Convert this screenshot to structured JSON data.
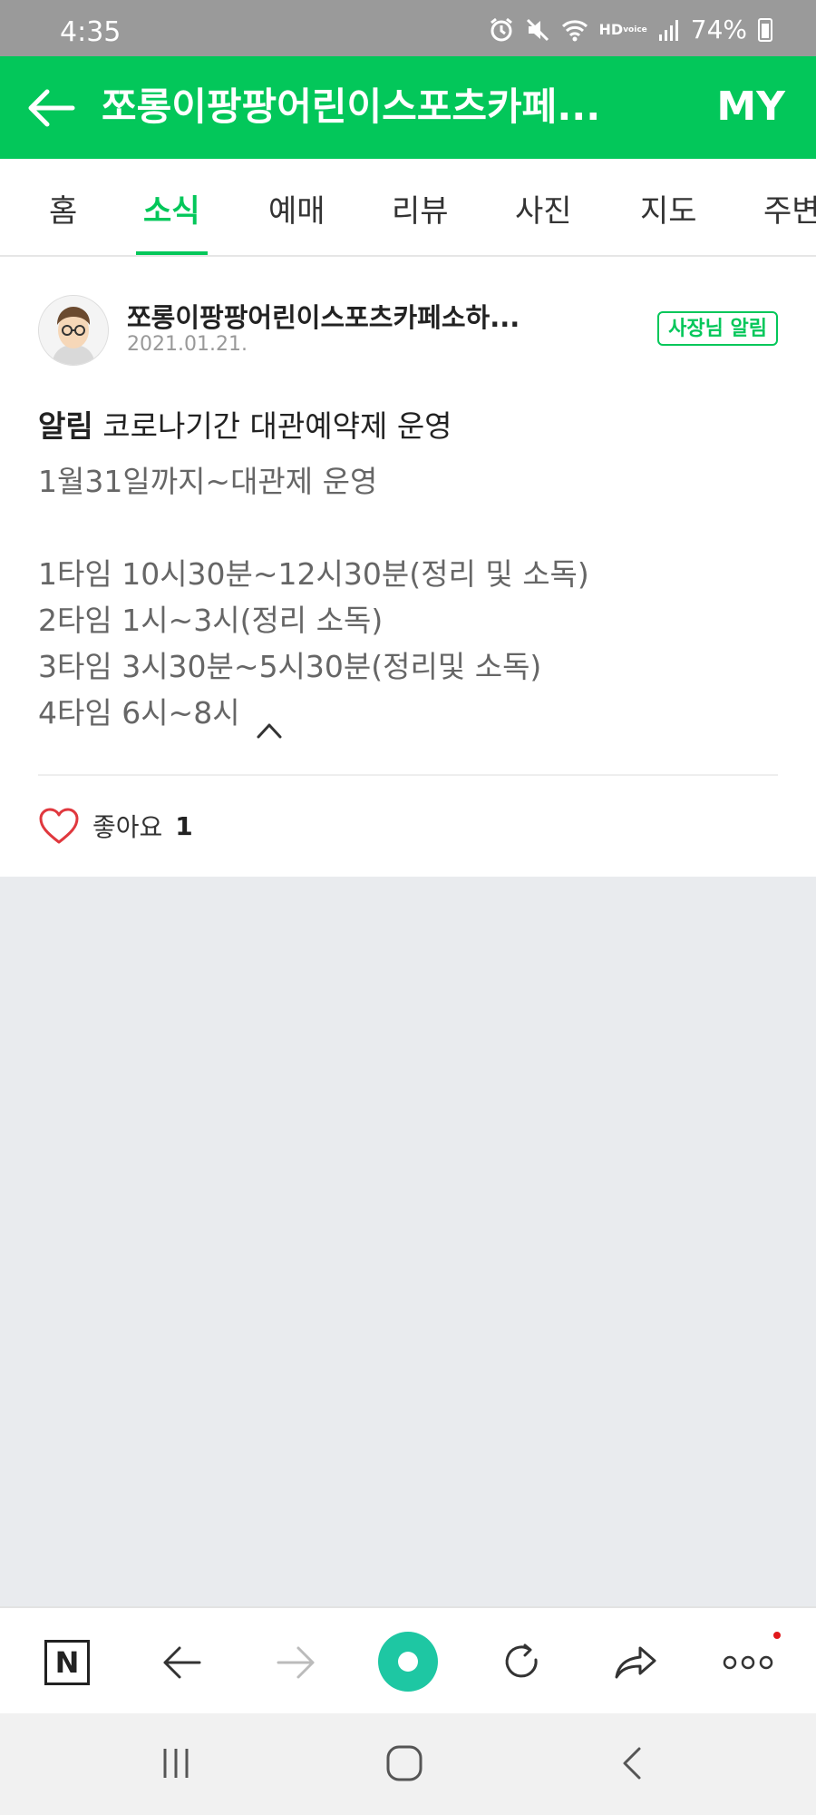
{
  "status_bar": {
    "time": "4:35",
    "hd": "HD",
    "hd_sub": "voice",
    "battery": "74%"
  },
  "header": {
    "title": "쪼롱이팡팡어린이스포츠카페...",
    "my_label": "MY"
  },
  "tabs": [
    {
      "label": "홈"
    },
    {
      "label": "소식"
    },
    {
      "label": "예매"
    },
    {
      "label": "리뷰"
    },
    {
      "label": "사진"
    },
    {
      "label": "지도"
    },
    {
      "label": "주변"
    }
  ],
  "post": {
    "author": "쪼롱이팡팡어린이스포츠카페소하...",
    "date": "2021.01.21.",
    "badge": "사장님 알림",
    "kind": "알림",
    "title": "코로나기간 대관예약제 운영",
    "body_lines": [
      "1월31일까지~대관제 운영",
      "",
      "1타임 10시30분~12시30분(정리 및 소독)",
      "2타임 1시~3시(정리 소독)",
      "3타임 3시30분~5시30분(정리및 소독)",
      "4타임 6시~8시"
    ],
    "like_label": "좋아요",
    "like_count": "1"
  },
  "colors": {
    "brand": "#03c75a",
    "status_bar": "#9a9a9a",
    "background": "#e9ebee"
  }
}
